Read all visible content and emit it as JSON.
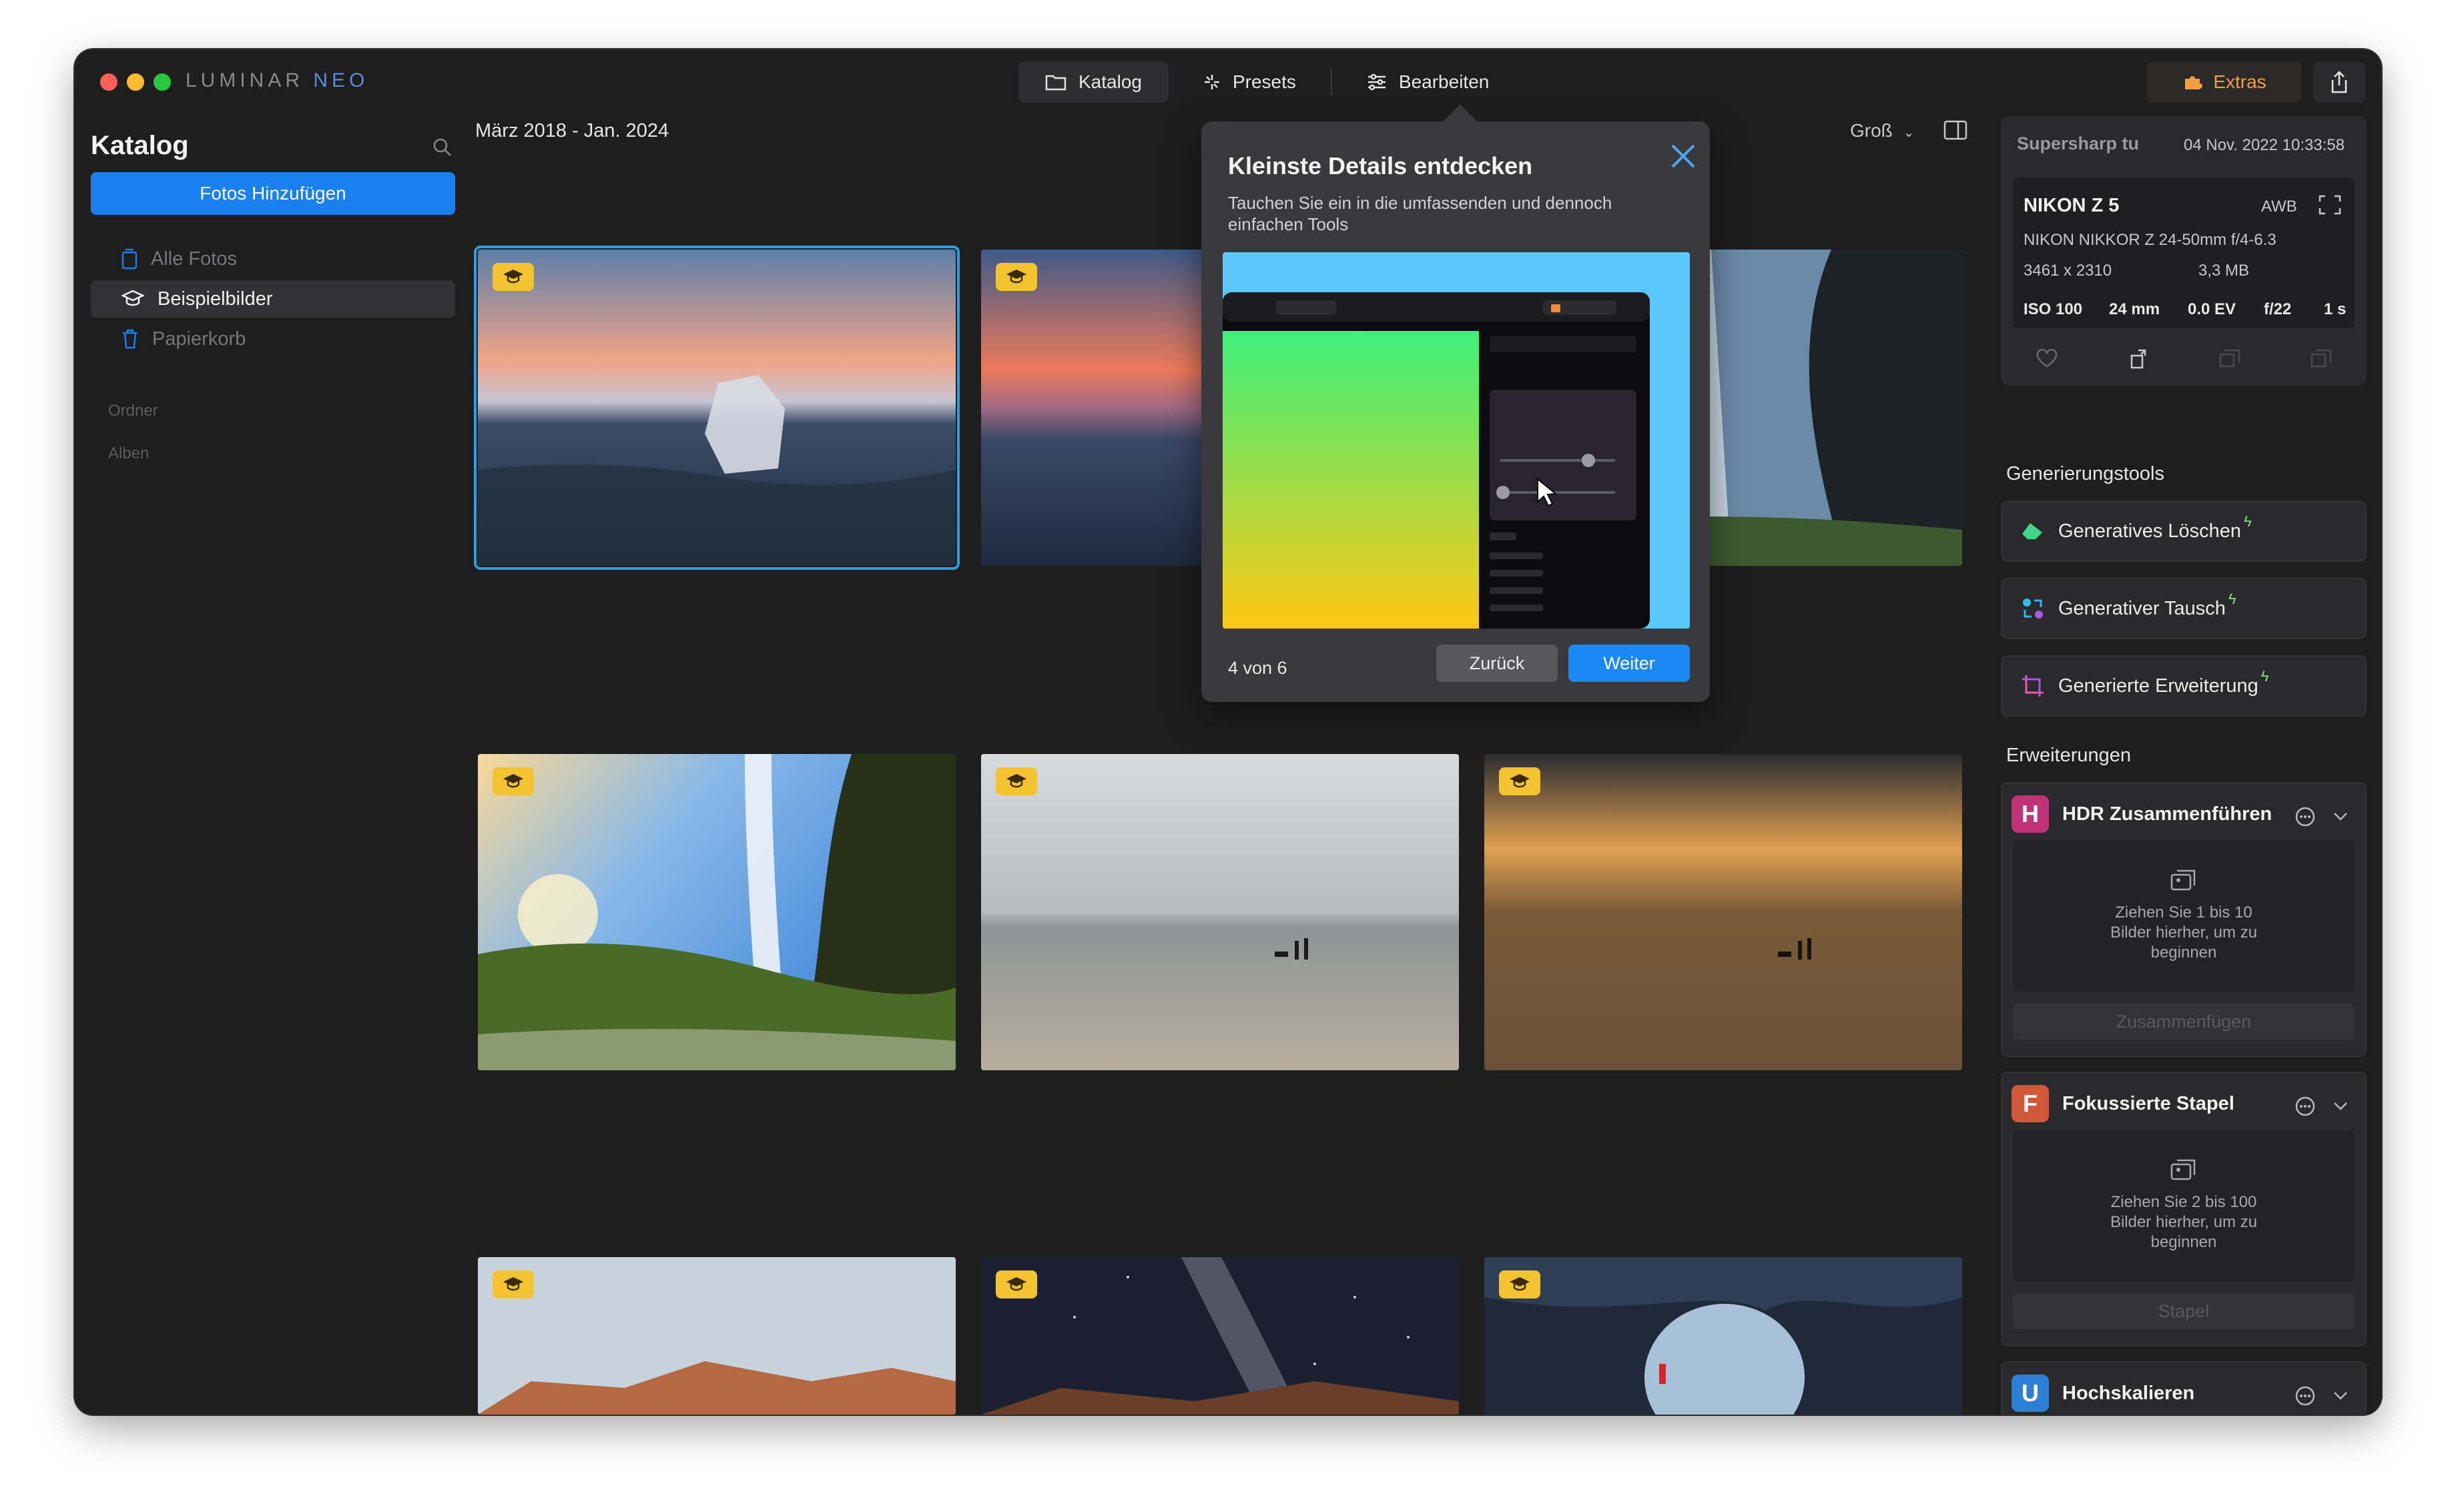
{
  "app": {
    "logo_part1": "LUMINAR",
    "logo_part2": "NEO"
  },
  "topnav": {
    "katalog": "Katalog",
    "presets": "Presets",
    "bearbeiten": "Bearbeiten",
    "extras": "Extras"
  },
  "sidebar": {
    "title": "Katalog",
    "add_button": "Fotos Hinzufügen",
    "items": [
      {
        "label": "Alle Fotos"
      },
      {
        "label": "Beispielbilder"
      },
      {
        "label": "Papierkorb"
      }
    ],
    "sections": [
      "Ordner",
      "Alben"
    ]
  },
  "content": {
    "date_range": "März 2018 - Jan. 2024",
    "view_size": "Groß"
  },
  "popover": {
    "title": "Kleinste Details entdecken",
    "description": "Tauchen Sie ein in die umfassenden und dennoch einfachen Tools",
    "step": "4 von 6",
    "back": "Zurück",
    "next": "Weiter"
  },
  "info": {
    "tool_name": "Supersharp tu",
    "date": "04 Nov. 2022 10:33:58",
    "camera": "NIKON Z 5",
    "wb": "AWB",
    "lens": "NIKON NIKKOR Z 24-50mm f/4-6.3",
    "dimensions": "3461 x 2310",
    "file_size": "3,3 MB",
    "iso": "ISO 100",
    "focal": "24 mm",
    "ev": "0.0 EV",
    "aperture": "f/22",
    "shutter": "1 s"
  },
  "gen_tools": {
    "title": "Generierungstools",
    "items": [
      {
        "label": "Generatives Löschen"
      },
      {
        "label": "Generativer Tausch"
      },
      {
        "label": "Generierte Erweiterung"
      }
    ]
  },
  "extensions": {
    "title": "Erweiterungen",
    "items": [
      {
        "letter": "H",
        "label": "HDR Zusammenführen",
        "drop": "Ziehen Sie 1 bis 10 Bilder hierher, um zu beginnen",
        "action": "Zusammenfügen",
        "color": "#c0337a"
      },
      {
        "letter": "F",
        "label": "Fokussierte Stapel",
        "drop": "Ziehen Sie 2 bis 100 Bilder hierher, um zu beginnen",
        "action": "Stapel",
        "color": "#d2563a"
      },
      {
        "letter": "U",
        "label": "Hochskalieren",
        "color": "#2c7fd4"
      }
    ]
  }
}
